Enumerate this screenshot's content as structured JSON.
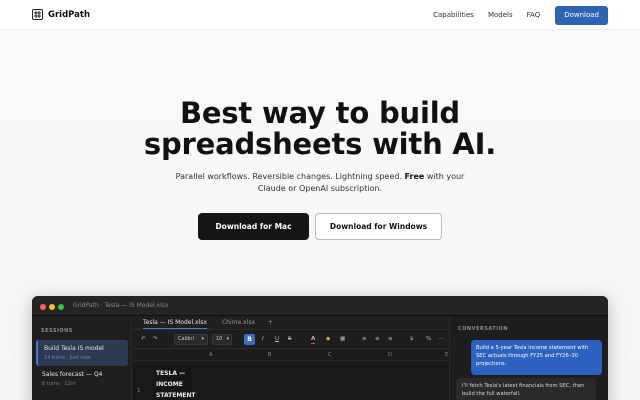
{
  "nav": {
    "brand": "GridPath",
    "links": [
      "Capabilities",
      "Models",
      "FAQ"
    ],
    "download_label": "Download",
    "accent_color": "#2d63b3"
  },
  "hero": {
    "title_line1": "Best way to build",
    "title_line2": "spreadsheets with AI.",
    "subtitle_part1": "Parallel workflows. Reversible changes. Lightning speed.",
    "subtitle_bold": "Free",
    "subtitle_part2": "with your",
    "subtitle_line2": "Claude or OpenAI subscription.",
    "btn_mac": "Download for Mac",
    "btn_windows": "Download for Windows"
  },
  "app": {
    "window_title": "GridPath · Tesla — IS Model.xlsx",
    "sidebar": {
      "heading": "SESSIONS",
      "sessions": [
        {
          "title": "Build Tesla IS model",
          "meta": "14 turns · just now"
        },
        {
          "title": "Sales forecast — Q4",
          "meta": "8 turns · 12m"
        }
      ]
    },
    "tabs": [
      "Tesla — IS Model.xlsx",
      "Chime.xlsx",
      "+"
    ],
    "toolbar": {
      "undo": "↶",
      "redo": "↷",
      "font": "Calibri",
      "font_caret": "▾",
      "size": "10",
      "size_caret": "▾",
      "bold": "B",
      "italic": "I",
      "underline": "U",
      "strike": "S",
      "text_color": "A",
      "fill": "◆",
      "borders": "▦",
      "align_left": "≡",
      "align_center": "≡",
      "align_right": "≡",
      "currency": "$",
      "percent": "%",
      "more": "⋯"
    },
    "columns": [
      "A",
      "B",
      "C",
      "D",
      "E"
    ],
    "row_number": "1",
    "cell_a1": "TESLA — INCOME STATEMENT",
    "chat": {
      "heading": "CONVERSATION",
      "user_message": "Build a 5-year Tesla income statement with SEC actuals through FY25 and FY26–30 projections.",
      "assistant_message": "I'll fetch Tesla's latest financials from SEC, then build the full waterfall."
    }
  }
}
